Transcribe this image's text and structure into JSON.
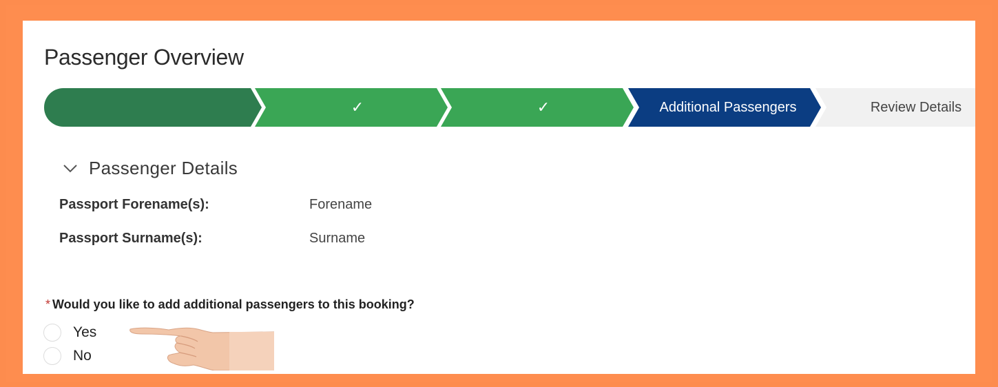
{
  "page": {
    "title": "Passenger Overview"
  },
  "progress_path": {
    "stages": [
      {
        "label": "",
        "state": "complete",
        "color": "#2e7d4f"
      },
      {
        "label": "✓",
        "state": "complete",
        "color": "#3aa655"
      },
      {
        "label": "✓",
        "state": "complete",
        "color": "#3aa655"
      },
      {
        "label": "Additional Passengers",
        "state": "current",
        "color": "#0b3d82"
      },
      {
        "label": "Review Details",
        "state": "incomplete",
        "color": "#f1f1f1"
      }
    ]
  },
  "section": {
    "title": "Passenger Details",
    "fields": [
      {
        "label": "Passport Forename(s):",
        "value": "Forename"
      },
      {
        "label": "Passport Surname(s):",
        "value": "Surname"
      }
    ]
  },
  "question": {
    "required_marker": "*",
    "text": "Would you like to add additional passengers to this booking?",
    "options": [
      {
        "label": "Yes",
        "selected": false
      },
      {
        "label": "No",
        "selected": false
      }
    ]
  },
  "colors": {
    "border_orange": "#fd8c4e",
    "required_red": "#c23934"
  }
}
